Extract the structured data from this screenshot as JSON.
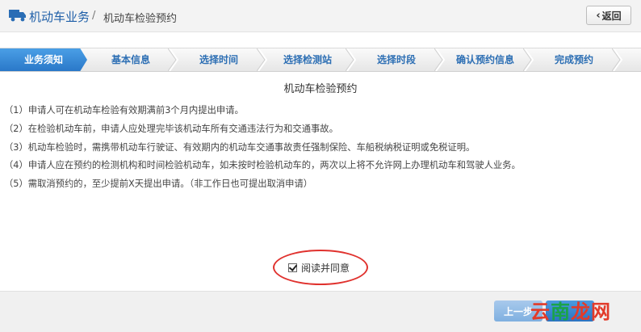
{
  "header": {
    "section": "机动车业务",
    "separator": "/",
    "page": "机动车检验预约",
    "back_label": "返回",
    "icon": "truck-icon"
  },
  "steps": [
    {
      "label": "业务须知",
      "active": true
    },
    {
      "label": "基本信息",
      "active": false
    },
    {
      "label": "选择时间",
      "active": false
    },
    {
      "label": "选择检测站",
      "active": false
    },
    {
      "label": "选择时段",
      "active": false
    },
    {
      "label": "确认预约信息",
      "active": false
    },
    {
      "label": "完成预约",
      "active": false
    }
  ],
  "content": {
    "title": "机动车检验预约",
    "rules": [
      "（1）申请人可在机动车检验有效期满前3个月内提出申请。",
      "（2）在检验机动车前，申请人应处理完毕该机动车所有交通违法行为和交通事故。",
      "（3）机动车检验时，需携带机动车行驶证、有效期内的机动车交通事故责任强制保险、车船税纳税证明或免税证明。",
      "（4）申请人应在预约的检测机构和时间检验机动车，如未按时检验机动车的，两次以上将不允许网上办理机动车和驾驶人业务。",
      "（5）需取消预约的，至少提前X天提出申请。（非工作日也可提出取消申请）"
    ]
  },
  "agree": {
    "label": "阅读并同意",
    "checked": true
  },
  "footer": {
    "prev_label": "上一步"
  },
  "watermark": {
    "part1": "云",
    "part2": "南",
    "part3": "龙网"
  },
  "colors": {
    "accent": "#2a78c8",
    "annotation": "#e0322e"
  }
}
